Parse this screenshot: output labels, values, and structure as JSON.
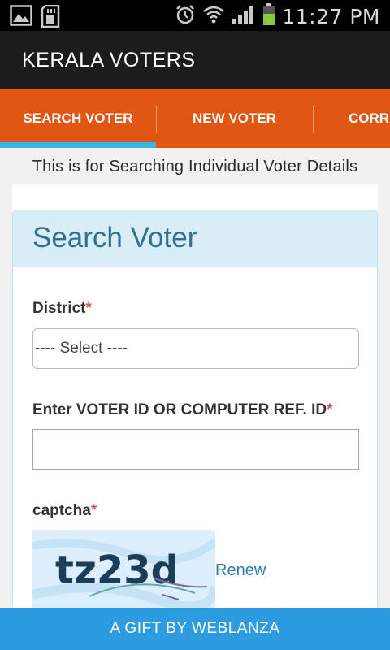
{
  "status_bar": {
    "time": "11:27 PM",
    "icons": [
      "image-icon",
      "sd-card-icon",
      "alarm-icon",
      "wifi-icon",
      "signal-icon",
      "battery-icon"
    ]
  },
  "app": {
    "title": "KERALA VOTERS"
  },
  "tabs": [
    {
      "label": "SEARCH VOTER",
      "selected": true
    },
    {
      "label": "NEW VOTER",
      "selected": false
    },
    {
      "label": "CORRE",
      "selected": false
    }
  ],
  "info_text": "This is for Searching Individual Voter Details",
  "panel": {
    "title": "Search Voter",
    "district": {
      "label": "District",
      "required_mark": "*",
      "selected": "---- Select ----"
    },
    "voter_id": {
      "label": "Enter VOTER ID OR COMPUTER REF. ID",
      "required_mark": "*",
      "value": ""
    },
    "captcha": {
      "label": "captcha",
      "required_mark": "*",
      "image_text": "tz23d",
      "renew_label": "Renew"
    }
  },
  "footer": {
    "text": "A GIFT BY WEBLANZA"
  },
  "colors": {
    "tab_bar": "#e15613",
    "tab_indicator": "#33b5e5",
    "panel_header": "#d9edf7",
    "panel_title": "#31708f",
    "footer": "#2c9be0",
    "required": "#d9534f",
    "link": "#2f7bb5"
  }
}
